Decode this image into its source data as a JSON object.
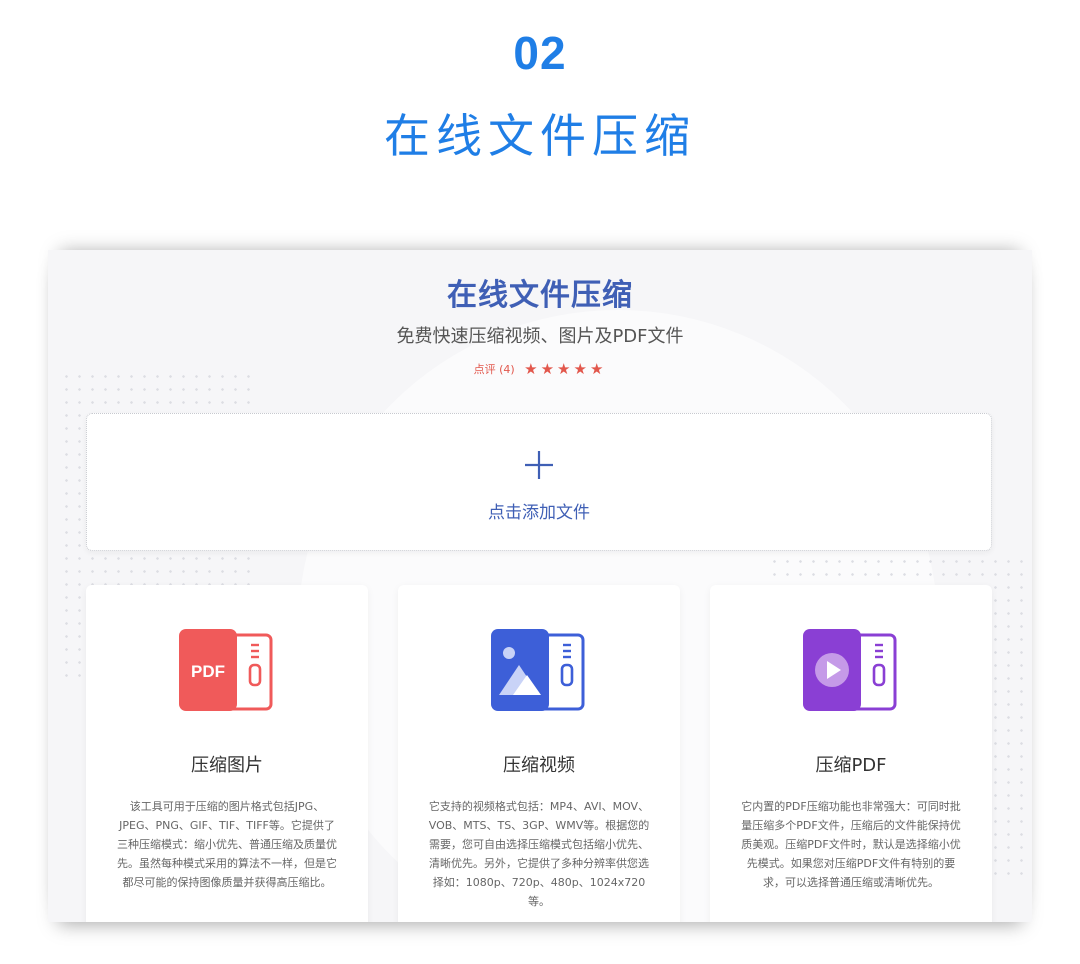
{
  "header": {
    "number": "02",
    "title": "在线文件压缩"
  },
  "app": {
    "title": "在线文件压缩",
    "subtitle": "免费快速压缩视频、图片及PDF文件",
    "rating_label": "点评 (4)",
    "stars": "★★★★★",
    "rating_value": 5,
    "upload_label": "点击添加文件"
  },
  "cards": [
    {
      "title": "压缩图片",
      "icon": "pdf-zip-icon",
      "icon_text": "PDF",
      "description": "该工具可用于压缩的图片格式包括JPG、JPEG、PNG、GIF、TIF、TIFF等。它提供了三种压缩模式：缩小优先、普通压缩及质量优先。虽然每种模式采用的算法不一样，但是它都尽可能的保持图像质量并获得高压缩比。"
    },
    {
      "title": "压缩视频",
      "icon": "image-zip-icon",
      "description": "它支持的视频格式包括：MP4、AVI、MOV、VOB、MTS、TS、3GP、WMV等。根据您的需要，您可自由选择压缩模式包括缩小优先、清晰优先。另外，它提供了多种分辨率供您选择如：1080p、720p、480p、1024x720等。"
    },
    {
      "title": "压缩PDF",
      "icon": "video-zip-icon",
      "description": "它内置的PDF压缩功能也非常强大：可同时批量压缩多个PDF文件，压缩后的文件能保持优质美观。压缩PDF文件时，默认是选择缩小优先模式。如果您对压缩PDF文件有特别的要求，可以选择普通压缩或清晰优先。"
    }
  ],
  "colors": {
    "heading_blue": "#1f7ee6",
    "app_title_blue": "#3f5fb5",
    "star_red": "#e2574c",
    "pdf_red": "#f05a5a",
    "image_blue": "#3d5fd8",
    "video_purple": "#8a3fd4"
  }
}
